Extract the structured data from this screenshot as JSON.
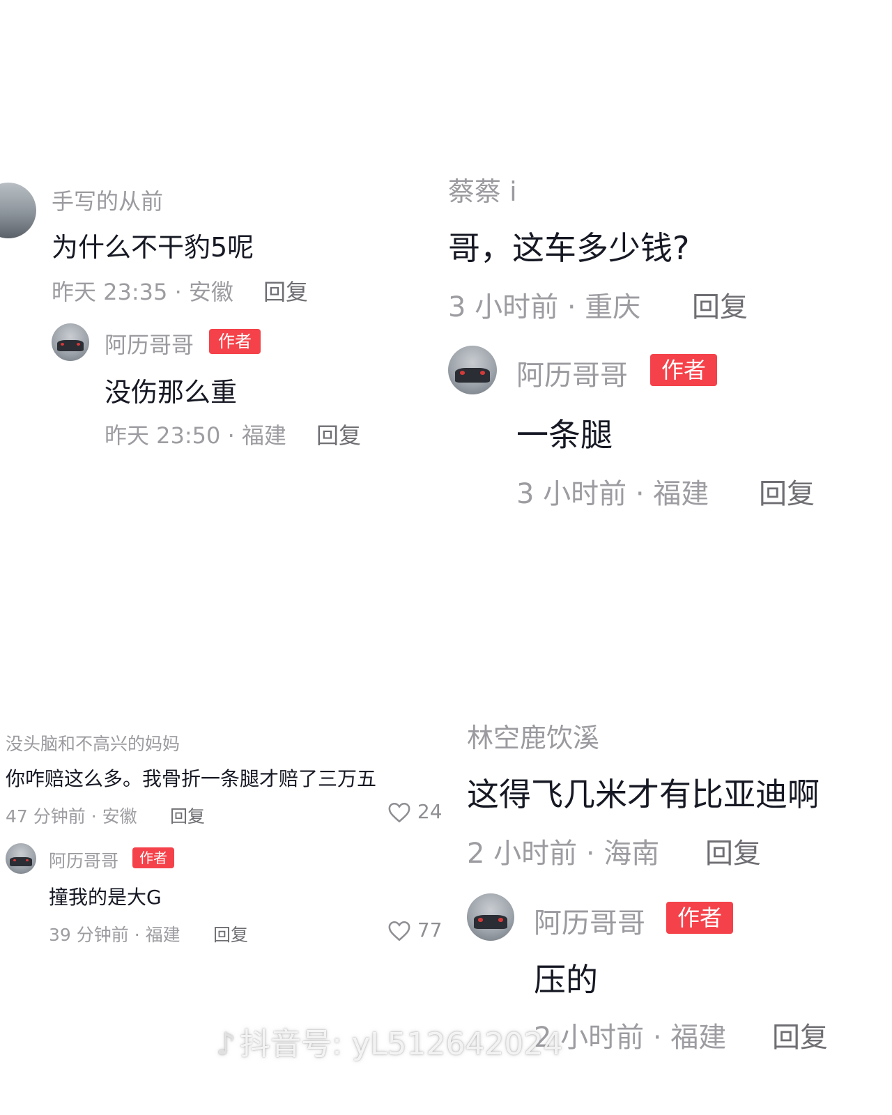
{
  "panels": [
    {
      "comment": {
        "user": "手写的从前",
        "text": "为什么不干豹5呢",
        "meta": "昨天 23:35 · 安徽",
        "reply": "回复"
      },
      "reply": {
        "author": "阿历哥哥",
        "badge": "作者",
        "text": "没伤那么重",
        "meta": "昨天 23:50 · 福建",
        "reply": "回复"
      }
    },
    {
      "comment": {
        "user": "蔡蔡 i",
        "text": "哥，这车多少钱?",
        "meta": "3 小时前 · 重庆",
        "reply": "回复"
      },
      "reply": {
        "author": "阿历哥哥",
        "badge": "作者",
        "text": "一条腿",
        "meta": "3 小时前 · 福建",
        "reply": "回复"
      }
    },
    {
      "comment": {
        "user": "没头脑和不高兴的妈妈",
        "text": "你咋赔这么多。我骨折一条腿才赔了三万五",
        "meta": "47 分钟前 · 安徽",
        "reply": "回复",
        "likes": "24"
      },
      "reply": {
        "author": "阿历哥哥",
        "badge": "作者",
        "text": "撞我的是大G",
        "meta": "39 分钟前 · 福建",
        "reply": "回复",
        "likes": "77"
      }
    },
    {
      "comment": {
        "user": "林空鹿饮溪",
        "text": "这得飞几米才有比亚迪啊",
        "meta": "2 小时前 · 海南",
        "reply": "回复"
      },
      "reply": {
        "author": "阿历哥哥",
        "badge": "作者",
        "text": "压的",
        "meta": "2 小时前 · 福建",
        "reply": "回复"
      }
    }
  ],
  "watermark": {
    "logo": "♪",
    "text": "抖音号: yL512642024"
  },
  "colors": {
    "badge": "#f5424a",
    "text": "#161823",
    "meta": "#9c9ca1",
    "username": "#9a9a9f"
  }
}
